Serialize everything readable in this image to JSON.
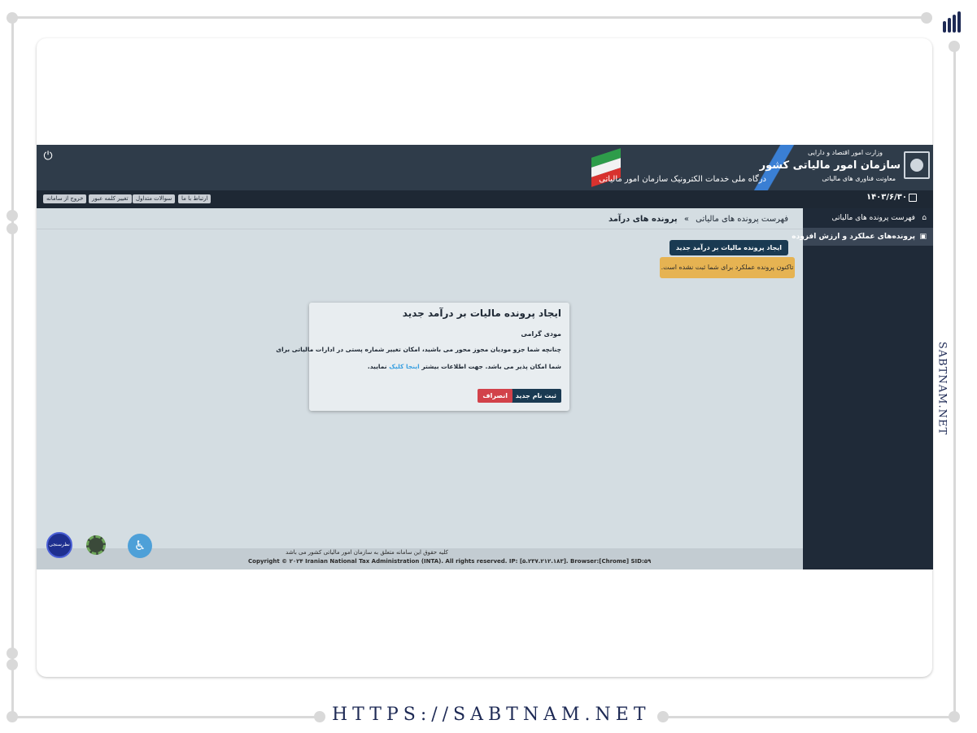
{
  "watermark": {
    "url": "HTTPS://SABTNAM.NET",
    "side_text": "SABTNAM.NET"
  },
  "header": {
    "ministry": "وزارت امور اقتصاد و دارایی",
    "org_name": "سازمان امور مالیاتی کشور",
    "deputy": "معاونت فناوری های مالیاتی",
    "portal": "درگاه ملی خدمات الکترونیک سازمان امور مالیاتی",
    "date": "۱۴۰۳/۶/۳۰"
  },
  "toolbar": {
    "exit": "خروج از سامانه",
    "change_password": "تغییر کلمه عبور",
    "faq": "سوالات متداول",
    "contact": "ارتباط با ما"
  },
  "sidebar": {
    "items": [
      {
        "label": "فهرست پرونده های مالیاتی",
        "icon": "home-icon"
      },
      {
        "label": "پرونده‌های عملکرد و ارزش افزوده",
        "icon": "folder-icon"
      }
    ]
  },
  "breadcrumb": {
    "parent": "فهرست پرونده های مالیاتی",
    "separator": "»",
    "current": "پرونده های درآمد"
  },
  "main": {
    "new_button": "ایجاد پرونده مالیات بر درآمد جدید",
    "alert": "تاکنون پرونده عملکرد برای شما ثبت نشده است."
  },
  "modal": {
    "title": "ایجاد پرونده مالیات بر درآمد جدید",
    "greeting": "مودی گرامی",
    "line1": "چنانچه شما جزو مودیان مجوز محور می باشید، امکان تغییر شماره پستی در ادارات مالیاتی برای",
    "line2_prefix": "شما امکان پذیر می باشد. جهت اطلاعات بیشتر",
    "line2_link": "اینجا کلیک",
    "line2_suffix": "نمایید.",
    "confirm": "ثبت نام جدید",
    "cancel": "انصراف"
  },
  "footer": {
    "rights_fa": "کلیه حقوق این سامانه متعلق به سازمان امور مالیاتی کشور می باشد",
    "copyright": "Copyright © ۲۰۲۴ Iranian National Tax Administration (INTA). All rights reserved. IP: [۵.۲۳۷.۲۱۲.۱۸۳]. Browser:[Chrome] SID:۵۹"
  },
  "badges": {
    "survey": "نظرسنجی"
  },
  "colors": {
    "header_bg": "#2f3c4a",
    "sidebar_bg": "#1f2a38",
    "primary_button": "#1a3a52",
    "alert_bg": "#e6b352",
    "cancel_button": "#d2424a",
    "content_bg": "#d4dde2"
  }
}
